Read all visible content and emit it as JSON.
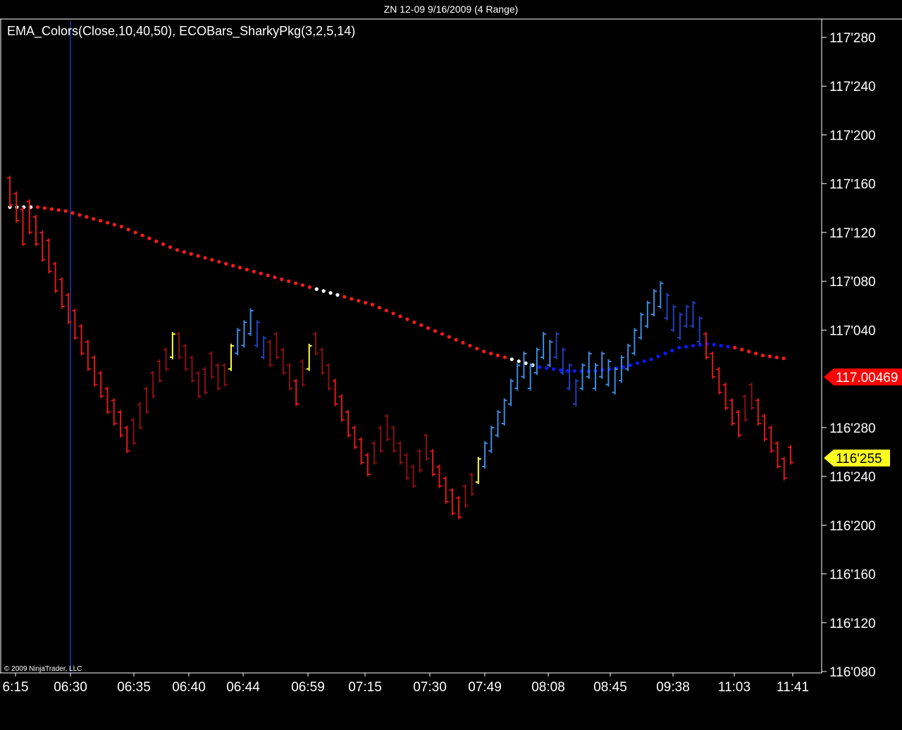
{
  "window": {
    "title": "ZN 12-09  9/16/2009 (4 Range)"
  },
  "indicator_label": "EMA_Colors(Close,10,40,50), ECOBars_SharkyPkg(3,2,5,14)",
  "copyright": "© 2009 NinjaTrader, LLC",
  "colors": {
    "background": "#000000",
    "axis": "#ffffff",
    "ema_down": "#ff1a1a",
    "ema_up": "#0a1aff",
    "ema_neutral": "#ffffff",
    "bar_red": "#e01818",
    "bar_darkred": "#8a1010",
    "bar_yellow": "#ffff40",
    "bar_blue": "#3a8ce0",
    "bar_darkblue": "#1f3fbf",
    "swing_dot": "#00e0ff",
    "cursor_line": "#2b5bff",
    "last_price_badge": "#ffff20",
    "ema_badge": "#ff0000"
  },
  "chart_data": {
    "type": "bar",
    "symbol": "ZN 12-09",
    "y_axis": {
      "ticks": [
        "117'280",
        "117'240",
        "117'200",
        "117'160",
        "117'120",
        "117'080",
        "117'040",
        "116'280",
        "116'240",
        "116'200",
        "116'160",
        "116'120",
        "116'080"
      ],
      "tick_values": [
        117.875,
        117.75,
        117.625,
        117.5,
        117.375,
        117.25,
        117.125,
        116.875,
        116.75,
        116.625,
        116.5,
        116.375,
        116.25
      ]
    },
    "x_axis": {
      "ticks": [
        "6:15",
        "06:30",
        "06:35",
        "06:40",
        "06:44",
        "06:59",
        "07:15",
        "07:30",
        "07:49",
        "08:08",
        "08:45",
        "09:38",
        "11:03",
        "11:41"
      ]
    },
    "price_badges": {
      "ema_value": "117.00469",
      "last_price": "116'255"
    },
    "bars": [
      {
        "h": 117.52,
        "l": 117.44,
        "c": "red"
      },
      {
        "h": 117.48,
        "l": 117.4,
        "c": "red"
      },
      {
        "h": 117.44,
        "l": 117.34,
        "c": "red"
      },
      {
        "h": 117.46,
        "l": 117.37,
        "c": "red"
      },
      {
        "h": 117.42,
        "l": 117.34,
        "c": "red"
      },
      {
        "h": 117.38,
        "l": 117.3,
        "c": "red"
      },
      {
        "h": 117.36,
        "l": 117.27,
        "c": "red"
      },
      {
        "h": 117.3,
        "l": 117.22,
        "c": "red"
      },
      {
        "h": 117.26,
        "l": 117.18,
        "c": "red"
      },
      {
        "h": 117.22,
        "l": 117.14,
        "c": "red"
      },
      {
        "h": 117.18,
        "l": 117.1,
        "c": "red"
      },
      {
        "h": 117.14,
        "l": 117.06,
        "c": "red"
      },
      {
        "h": 117.1,
        "l": 117.02,
        "c": "red"
      },
      {
        "h": 117.06,
        "l": 116.98,
        "c": "red"
      },
      {
        "h": 117.02,
        "l": 116.95,
        "c": "red"
      },
      {
        "h": 116.98,
        "l": 116.91,
        "c": "red"
      },
      {
        "h": 116.95,
        "l": 116.88,
        "c": "red"
      },
      {
        "h": 116.92,
        "l": 116.85,
        "c": "red"
      },
      {
        "h": 116.88,
        "l": 116.81,
        "c": "red"
      },
      {
        "h": 116.9,
        "l": 116.83,
        "c": "darkred"
      },
      {
        "h": 116.94,
        "l": 116.87,
        "c": "darkred"
      },
      {
        "h": 116.98,
        "l": 116.91,
        "c": "darkred"
      },
      {
        "h": 117.02,
        "l": 116.95,
        "c": "darkred"
      },
      {
        "h": 117.05,
        "l": 116.99,
        "c": "darkred"
      },
      {
        "h": 117.08,
        "l": 117.02,
        "c": "darkred"
      },
      {
        "h": 117.12,
        "l": 117.05,
        "c": "yellow"
      },
      {
        "h": 117.12,
        "l": 117.05,
        "c": "darkred"
      },
      {
        "h": 117.09,
        "l": 117.02,
        "c": "darkred"
      },
      {
        "h": 117.06,
        "l": 116.99,
        "c": "darkred"
      },
      {
        "h": 117.02,
        "l": 116.95,
        "c": "darkred"
      },
      {
        "h": 117.03,
        "l": 116.96,
        "c": "darkred"
      },
      {
        "h": 117.07,
        "l": 117.0,
        "c": "darkred"
      },
      {
        "h": 117.04,
        "l": 116.97,
        "c": "darkred"
      },
      {
        "h": 117.04,
        "l": 116.98,
        "c": "darkred"
      },
      {
        "h": 117.09,
        "l": 117.02,
        "c": "yellow"
      },
      {
        "h": 117.13,
        "l": 117.06,
        "c": "blue"
      },
      {
        "h": 117.15,
        "l": 117.08,
        "c": "blue"
      },
      {
        "h": 117.18,
        "l": 117.11,
        "c": "blue"
      },
      {
        "h": 117.15,
        "l": 117.08,
        "c": "darkblue"
      },
      {
        "h": 117.11,
        "l": 117.05,
        "c": "darkblue"
      },
      {
        "h": 117.1,
        "l": 117.03,
        "c": "darkred"
      },
      {
        "h": 117.12,
        "l": 117.05,
        "c": "darkred"
      },
      {
        "h": 117.08,
        "l": 117.01,
        "c": "darkred"
      },
      {
        "h": 117.04,
        "l": 116.97,
        "c": "darkred"
      },
      {
        "h": 117.0,
        "l": 116.93,
        "c": "red"
      },
      {
        "h": 117.05,
        "l": 116.98,
        "c": "darkred"
      },
      {
        "h": 117.09,
        "l": 117.02,
        "c": "yellow"
      },
      {
        "h": 117.12,
        "l": 117.06,
        "c": "darkred"
      },
      {
        "h": 117.08,
        "l": 117.01,
        "c": "darkred"
      },
      {
        "h": 117.04,
        "l": 116.97,
        "c": "darkred"
      },
      {
        "h": 117.0,
        "l": 116.93,
        "c": "red"
      },
      {
        "h": 116.96,
        "l": 116.89,
        "c": "red"
      },
      {
        "h": 116.92,
        "l": 116.85,
        "c": "red"
      },
      {
        "h": 116.88,
        "l": 116.82,
        "c": "red"
      },
      {
        "h": 116.85,
        "l": 116.78,
        "c": "red"
      },
      {
        "h": 116.81,
        "l": 116.75,
        "c": "red"
      },
      {
        "h": 116.84,
        "l": 116.78,
        "c": "darkred"
      },
      {
        "h": 116.88,
        "l": 116.81,
        "c": "darkred"
      },
      {
        "h": 116.91,
        "l": 116.84,
        "c": "darkred"
      },
      {
        "h": 116.88,
        "l": 116.81,
        "c": "darkred"
      },
      {
        "h": 116.84,
        "l": 116.78,
        "c": "darkred"
      },
      {
        "h": 116.81,
        "l": 116.74,
        "c": "darkred"
      },
      {
        "h": 116.78,
        "l": 116.72,
        "c": "darkred"
      },
      {
        "h": 116.82,
        "l": 116.76,
        "c": "darkred"
      },
      {
        "h": 116.86,
        "l": 116.79,
        "c": "darkred"
      },
      {
        "h": 116.82,
        "l": 116.75,
        "c": "red"
      },
      {
        "h": 116.78,
        "l": 116.72,
        "c": "red"
      },
      {
        "h": 116.75,
        "l": 116.68,
        "c": "red"
      },
      {
        "h": 116.72,
        "l": 116.65,
        "c": "red"
      },
      {
        "h": 116.7,
        "l": 116.64,
        "c": "red"
      },
      {
        "h": 116.73,
        "l": 116.67,
        "c": "darkred"
      },
      {
        "h": 116.76,
        "l": 116.7,
        "c": "darkred"
      },
      {
        "h": 116.8,
        "l": 116.73,
        "c": "yellow"
      },
      {
        "h": 116.84,
        "l": 116.77,
        "c": "blue"
      },
      {
        "h": 116.88,
        "l": 116.81,
        "c": "blue"
      },
      {
        "h": 116.92,
        "l": 116.85,
        "c": "blue"
      },
      {
        "h": 116.95,
        "l": 116.88,
        "c": "blue"
      },
      {
        "h": 117.0,
        "l": 116.93,
        "c": "blue"
      },
      {
        "h": 117.04,
        "l": 116.97,
        "c": "blue"
      },
      {
        "h": 117.07,
        "l": 117.0,
        "c": "blue"
      },
      {
        "h": 117.04,
        "l": 116.97,
        "c": "blue"
      },
      {
        "h": 117.08,
        "l": 117.01,
        "c": "blue"
      },
      {
        "h": 117.12,
        "l": 117.05,
        "c": "blue"
      },
      {
        "h": 117.1,
        "l": 117.03,
        "c": "blue"
      },
      {
        "h": 117.12,
        "l": 117.05,
        "c": "darkblue"
      },
      {
        "h": 117.08,
        "l": 117.01,
        "c": "darkblue"
      },
      {
        "h": 117.04,
        "l": 116.97,
        "c": "darkblue"
      },
      {
        "h": 117.0,
        "l": 116.93,
        "c": "darkblue"
      },
      {
        "h": 117.04,
        "l": 116.97,
        "c": "blue"
      },
      {
        "h": 117.07,
        "l": 117.0,
        "c": "blue"
      },
      {
        "h": 117.04,
        "l": 116.97,
        "c": "blue"
      },
      {
        "h": 117.07,
        "l": 117.0,
        "c": "blue"
      },
      {
        "h": 117.05,
        "l": 116.98,
        "c": "blue"
      },
      {
        "h": 117.03,
        "l": 116.96,
        "c": "blue"
      },
      {
        "h": 117.06,
        "l": 116.99,
        "c": "blue"
      },
      {
        "h": 117.09,
        "l": 117.02,
        "c": "blue"
      },
      {
        "h": 117.13,
        "l": 117.06,
        "c": "blue"
      },
      {
        "h": 117.17,
        "l": 117.1,
        "c": "blue"
      },
      {
        "h": 117.2,
        "l": 117.13,
        "c": "blue"
      },
      {
        "h": 117.23,
        "l": 117.16,
        "c": "blue"
      },
      {
        "h": 117.25,
        "l": 117.18,
        "c": "blue"
      },
      {
        "h": 117.22,
        "l": 117.15,
        "c": "darkblue"
      },
      {
        "h": 117.19,
        "l": 117.12,
        "c": "darkblue"
      },
      {
        "h": 117.17,
        "l": 117.1,
        "c": "darkblue"
      },
      {
        "h": 117.19,
        "l": 117.13,
        "c": "darkblue"
      },
      {
        "h": 117.2,
        "l": 117.13,
        "c": "darkblue"
      },
      {
        "h": 117.16,
        "l": 117.09,
        "c": "darkblue"
      },
      {
        "h": 117.12,
        "l": 117.05,
        "c": "red"
      },
      {
        "h": 117.07,
        "l": 117.0,
        "c": "red"
      },
      {
        "h": 117.03,
        "l": 116.96,
        "c": "red"
      },
      {
        "h": 116.99,
        "l": 116.92,
        "c": "red"
      },
      {
        "h": 116.95,
        "l": 116.88,
        "c": "red"
      },
      {
        "h": 116.92,
        "l": 116.85,
        "c": "red"
      },
      {
        "h": 116.96,
        "l": 116.89,
        "c": "darkred"
      },
      {
        "h": 116.99,
        "l": 116.92,
        "c": "darkred"
      },
      {
        "h": 116.95,
        "l": 116.88,
        "c": "red"
      },
      {
        "h": 116.91,
        "l": 116.84,
        "c": "red"
      },
      {
        "h": 116.88,
        "l": 116.81,
        "c": "red"
      },
      {
        "h": 116.84,
        "l": 116.77,
        "c": "red"
      },
      {
        "h": 116.8,
        "l": 116.74,
        "c": "red"
      },
      {
        "h": 116.83,
        "l": 116.78,
        "c": "red"
      }
    ],
    "ema": {
      "values": [
        117.44,
        117.44,
        117.43,
        117.41,
        117.39,
        117.36,
        117.33,
        117.31,
        117.29,
        117.27,
        117.25,
        117.23,
        117.21,
        117.19,
        117.16,
        117.13,
        117.1,
        117.07,
        117.05,
        117.03,
        117.02,
        117.02,
        117.03,
        117.05,
        117.08,
        117.09,
        117.08,
        117.06,
        117.05
      ],
      "segment_colors": [
        "neutral",
        "down",
        "down",
        "down",
        "down",
        "down",
        "down",
        "down",
        "down",
        "down",
        "down",
        "neutral",
        "down",
        "down",
        "down",
        "down",
        "down",
        "down",
        "neutral",
        "up",
        "up",
        "up",
        "up",
        "up",
        "up",
        "up",
        "down",
        "down",
        "down"
      ]
    }
  }
}
